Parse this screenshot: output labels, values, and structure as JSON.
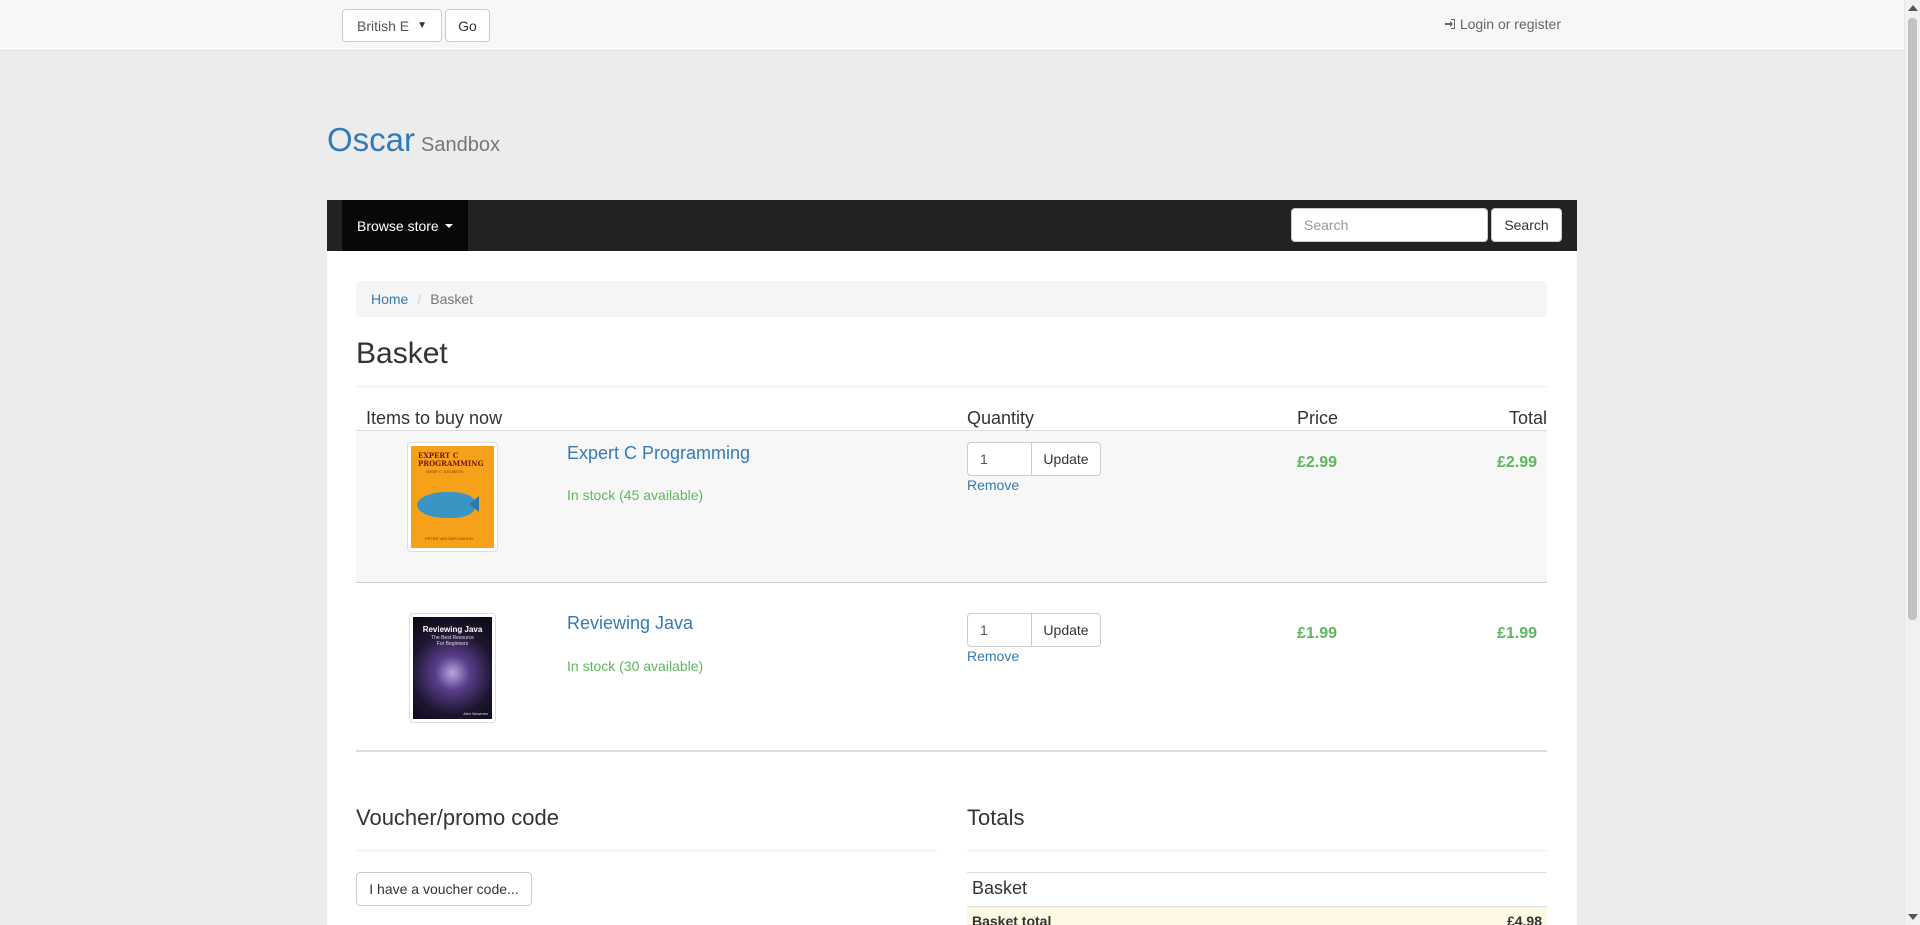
{
  "topbar": {
    "language_value": "British E",
    "go_label": "Go",
    "login_label": "Login or register"
  },
  "brand": {
    "main": "Oscar",
    "sub": "Sandbox"
  },
  "navbar": {
    "browse_label": "Browse store",
    "search_placeholder": "Search",
    "search_button": "Search"
  },
  "breadcrumb": {
    "home": "Home",
    "current": "Basket"
  },
  "page_title": "Basket",
  "basket": {
    "headers": {
      "items": "Items to buy now",
      "quantity": "Quantity",
      "price": "Price",
      "total": "Total"
    },
    "lines": [
      {
        "title": "Expert C Programming",
        "stock": "In stock (45 available)",
        "quantity": "1",
        "update_label": "Update",
        "remove_label": "Remove",
        "price": "£2.99",
        "total": "£2.99",
        "cover": {
          "title_line1": "EXPERT C",
          "title_line2": "PROGRAMMING",
          "subtitle": "DEEP C SECRETS",
          "author": "PETER VAN DER LINDEN"
        }
      },
      {
        "title": "Reviewing Java",
        "stock": "In stock (30 available)",
        "quantity": "1",
        "update_label": "Update",
        "remove_label": "Remove",
        "price": "£1.99",
        "total": "£1.99",
        "cover": {
          "title": "Reviewing Java",
          "subtitle_line1": "The Best Resource",
          "subtitle_line2": "For Beginners",
          "author": "Alex Newman"
        }
      }
    ]
  },
  "voucher": {
    "title": "Voucher/promo code",
    "button": "I have a voucher code..."
  },
  "totals": {
    "title": "Totals",
    "basket_label": "Basket",
    "basket_total_label": "Basket total",
    "basket_total_value": "£4.98"
  },
  "colors": {
    "link": "#337ab7",
    "success": "#5cb85c",
    "navbar": "#222222",
    "total_row": "#fcf8e3"
  }
}
